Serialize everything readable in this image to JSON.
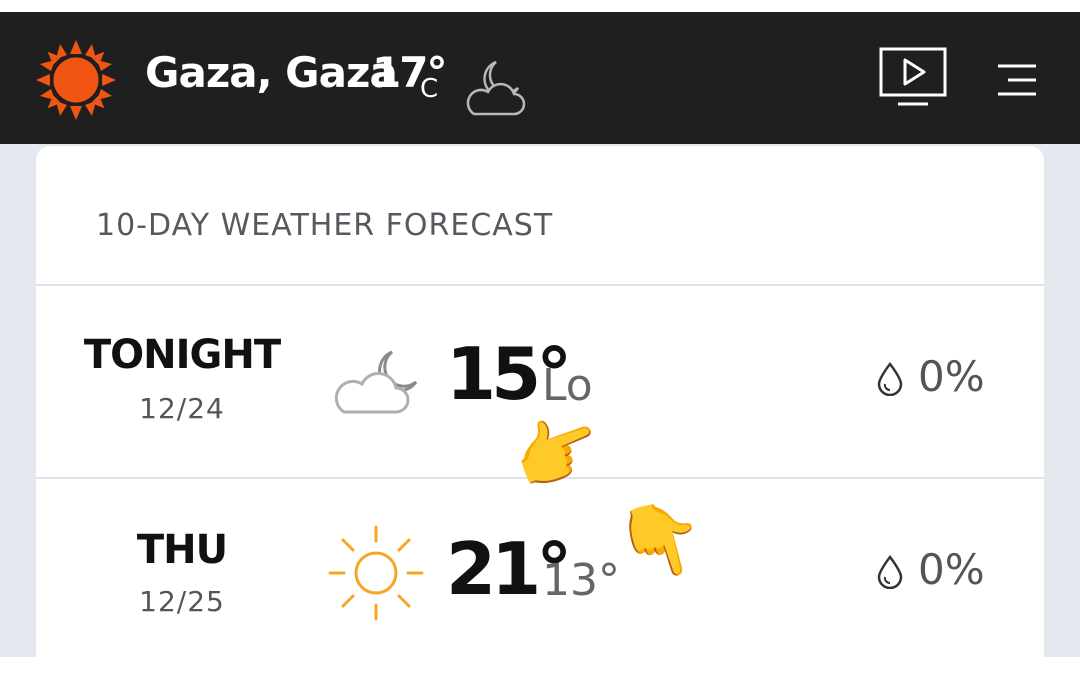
{
  "header": {
    "location": "Gaza, Gaza",
    "current_temp": "17°",
    "unit": "C",
    "condition_icon": "partly-cloudy-night-icon",
    "logo_icon": "sun-logo-icon",
    "video_icon": "play-video-icon",
    "menu_icon": "hamburger-menu-icon"
  },
  "forecast": {
    "title": "10-DAY WEATHER FORECAST",
    "days": [
      {
        "day": "TONIGHT",
        "date": "12/24",
        "icon": "partly-cloudy-night-icon",
        "high": "15°",
        "low": "Lo",
        "precip": "0%"
      },
      {
        "day": "THU",
        "date": "12/25",
        "icon": "sunny-icon",
        "high": "21°",
        "low": "13°",
        "precip": "0%"
      }
    ]
  },
  "overlays": {
    "emoji_1": "👉",
    "emoji_2": "👇"
  },
  "colors": {
    "header_bg": "#1f1f1f",
    "brand_orange": "#f05514",
    "sun_orange": "#f5a623",
    "page_bg": "#e4e9ef"
  }
}
